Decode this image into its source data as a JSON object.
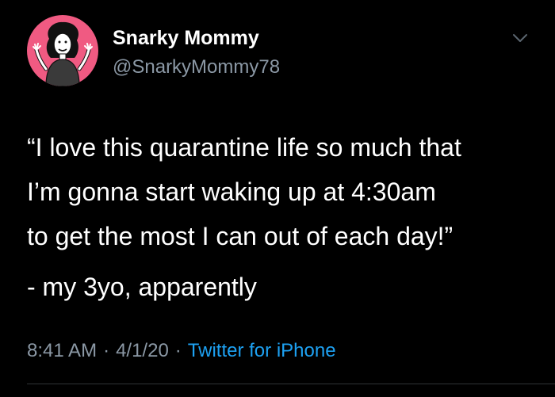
{
  "user": {
    "display_name": "Snarky Mommy",
    "handle": "@SnarkyMommy78",
    "avatar_icon": "cartoon-woman-avatar",
    "avatar_bg": "#f05a82"
  },
  "menu_icon": "chevron-down-icon",
  "tweet": {
    "lines": [
      "“I love this quarantine life so much that",
      "I’m gonna start waking up at 4:30am",
      "to get the most I can out of each day!”"
    ],
    "attribution": "- my 3yo, apparently"
  },
  "meta": {
    "time": "8:41 AM",
    "separator": "·",
    "date": "4/1/20",
    "source": "Twitter for iPhone"
  },
  "colors": {
    "background": "#000000",
    "text": "#ffffff",
    "secondary": "#8b98a5",
    "link": "#1da1f2"
  }
}
